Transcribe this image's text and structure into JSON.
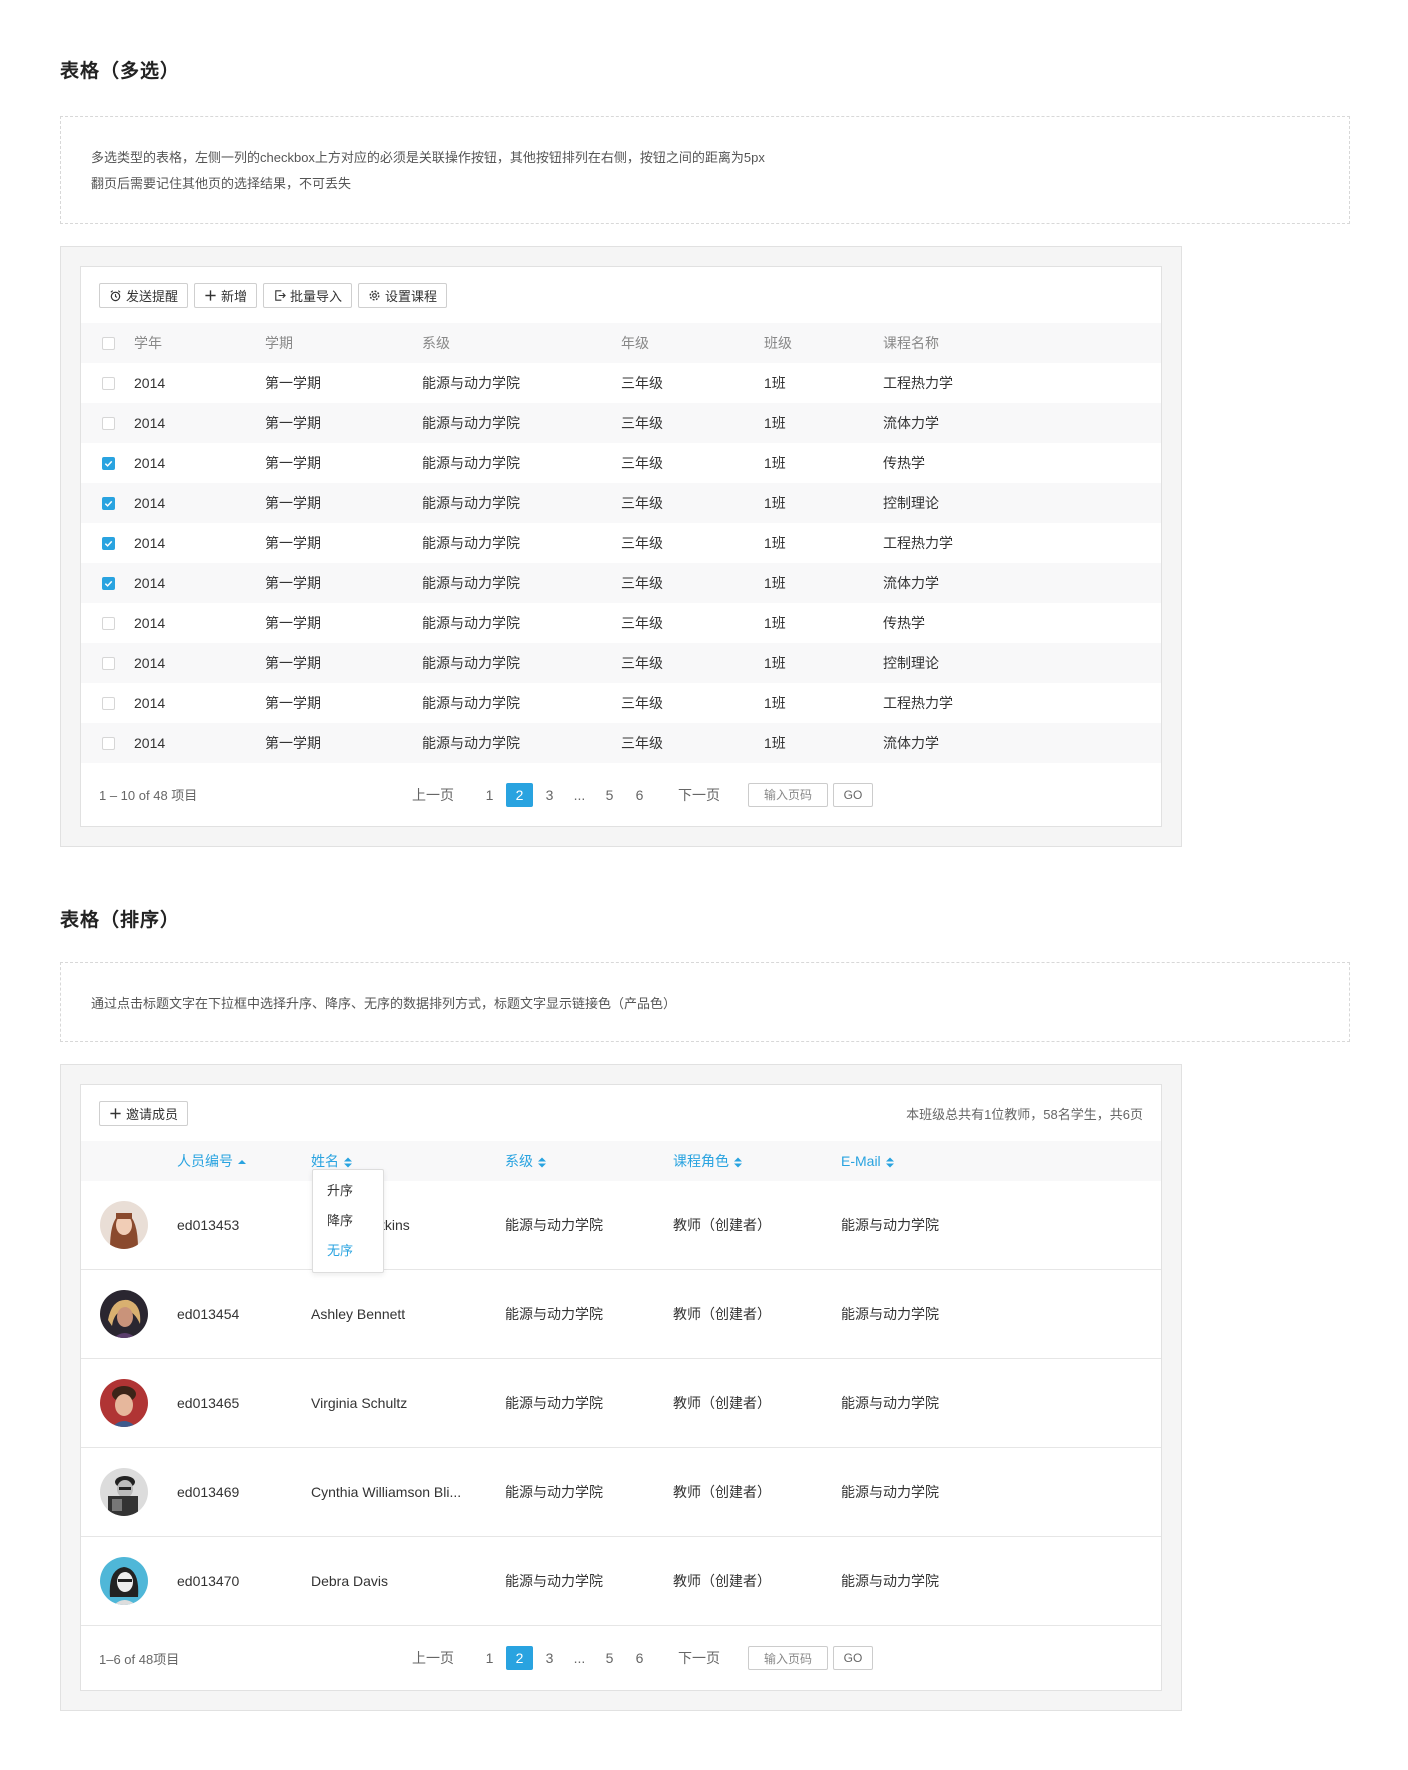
{
  "section1": {
    "title": "表格（多选）",
    "note_line1": "多选类型的表格，左侧一列的checkbox上方对应的必须是关联操作按钮，其他按钮排列在右侧，按钮之间的距离为5px",
    "note_line2": "翻页后需要记住其他页的选择结果，不可丢失",
    "toolbar": {
      "remind": "发送提醒",
      "add": "新增",
      "import": "批量导入",
      "settings": "设置课程"
    },
    "columns": [
      "学年",
      "学期",
      "系级",
      "年级",
      "班级",
      "课程名称"
    ],
    "rows": [
      {
        "checked": false,
        "cells": [
          "2014",
          "第一学期",
          "能源与动力学院",
          "三年级",
          "1班",
          "工程热力学"
        ]
      },
      {
        "checked": false,
        "cells": [
          "2014",
          "第一学期",
          "能源与动力学院",
          "三年级",
          "1班",
          "流体力学"
        ]
      },
      {
        "checked": true,
        "cells": [
          "2014",
          "第一学期",
          "能源与动力学院",
          "三年级",
          "1班",
          "传热学"
        ]
      },
      {
        "checked": true,
        "cells": [
          "2014",
          "第一学期",
          "能源与动力学院",
          "三年级",
          "1班",
          "控制理论"
        ]
      },
      {
        "checked": true,
        "cells": [
          "2014",
          "第一学期",
          "能源与动力学院",
          "三年级",
          "1班",
          "工程热力学"
        ]
      },
      {
        "checked": true,
        "cells": [
          "2014",
          "第一学期",
          "能源与动力学院",
          "三年级",
          "1班",
          "流体力学"
        ]
      },
      {
        "checked": false,
        "cells": [
          "2014",
          "第一学期",
          "能源与动力学院",
          "三年级",
          "1班",
          "传热学"
        ]
      },
      {
        "checked": false,
        "cells": [
          "2014",
          "第一学期",
          "能源与动力学院",
          "三年级",
          "1班",
          "控制理论"
        ]
      },
      {
        "checked": false,
        "cells": [
          "2014",
          "第一学期",
          "能源与动力学院",
          "三年级",
          "1班",
          "工程热力学"
        ]
      },
      {
        "checked": false,
        "cells": [
          "2014",
          "第一学期",
          "能源与动力学院",
          "三年级",
          "1班",
          "流体力学"
        ]
      }
    ],
    "pager": {
      "info": "1 – 10 of 48 项目",
      "prev": "上一页",
      "next": "下一页",
      "pages": [
        "1",
        "2",
        "3",
        "...",
        "5",
        "6"
      ],
      "active": "2",
      "input_placeholder": "输入页码",
      "go": "GO"
    }
  },
  "section2": {
    "title": "表格（排序）",
    "note": "通过点击标题文字在下拉框中选择升序、降序、无序的数据排列方式，标题文字显示链接色（产品色）",
    "invite": "邀请成员",
    "summary": "本班级总共有1位教师，58名学生，共6页",
    "columns": [
      "人员编号",
      "姓名",
      "系级",
      "课程角色",
      "E-Mail"
    ],
    "dropdown": [
      "升序",
      "降序",
      "无序"
    ],
    "dropdown_selected": "无序",
    "rows": [
      {
        "id": "ed013453",
        "name": "tkins",
        "dept": "能源与动力学院",
        "role": "教师（创建者）",
        "email": "能源与动力学院"
      },
      {
        "id": "ed013454",
        "name": "Ashley Bennett",
        "dept": "能源与动力学院",
        "role": "教师（创建者）",
        "email": "能源与动力学院"
      },
      {
        "id": "ed013465",
        "name": "Virginia Schultz",
        "dept": "能源与动力学院",
        "role": "教师（创建者）",
        "email": "能源与动力学院"
      },
      {
        "id": "ed013469",
        "name": "Cynthia Williamson Bli...",
        "dept": "能源与动力学院",
        "role": "教师（创建者）",
        "email": "能源与动力学院"
      },
      {
        "id": "ed013470",
        "name": "Debra Davis",
        "dept": "能源与动力学院",
        "role": "教师（创建者）",
        "email": "能源与动力学院"
      }
    ],
    "pager": {
      "info": "1–6 of 48项目",
      "prev": "上一页",
      "next": "下一页",
      "pages": [
        "1",
        "2",
        "3",
        "...",
        "5",
        "6"
      ],
      "active": "2",
      "input_placeholder": "输入页码",
      "go": "GO"
    }
  },
  "colors": {
    "accent": "#29a3e0",
    "border": "#e1e1e1",
    "panel_bg": "#f5f5f5"
  }
}
